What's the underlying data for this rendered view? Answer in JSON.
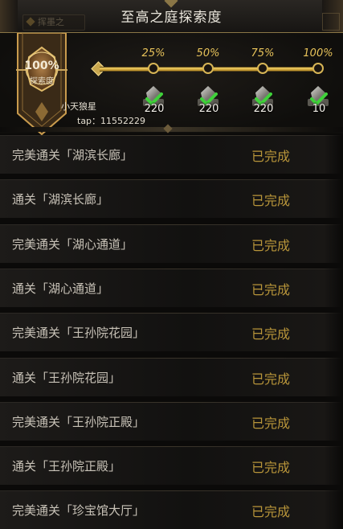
{
  "header": {
    "title": "至高之庭探索度",
    "ghost_tab_label": "挥墨之"
  },
  "badge": {
    "percent": "100%",
    "label": "探索度"
  },
  "progress": {
    "value_percent": 100,
    "milestones": [
      {
        "label": "25%",
        "reward_qty": "220",
        "claimed": true
      },
      {
        "label": "50%",
        "reward_qty": "220",
        "claimed": true
      },
      {
        "label": "75%",
        "reward_qty": "220",
        "claimed": true
      },
      {
        "label": "100%",
        "reward_qty": "10",
        "claimed": true
      }
    ]
  },
  "watermark": {
    "name": "小天狼星",
    "tap": "tap：11552229"
  },
  "tasks": [
    {
      "name": "完美通关「湖滨长廊」",
      "status": "已完成"
    },
    {
      "name": "通关「湖滨长廊」",
      "status": "已完成"
    },
    {
      "name": "完美通关「湖心通道」",
      "status": "已完成"
    },
    {
      "name": "通关「湖心通道」",
      "status": "已完成"
    },
    {
      "name": "完美通关「王孙院花园」",
      "status": "已完成"
    },
    {
      "name": "通关「王孙院花园」",
      "status": "已完成"
    },
    {
      "name": "完美通关「王孙院正殿」",
      "status": "已完成"
    },
    {
      "name": "通关「王孙院正殿」",
      "status": "已完成"
    },
    {
      "name": "完美通关「珍宝馆大厅」",
      "status": "已完成"
    }
  ],
  "colors": {
    "accent_gold": "#e8c35a",
    "status_gold": "#b8953a",
    "check_green": "#3fd23a"
  }
}
